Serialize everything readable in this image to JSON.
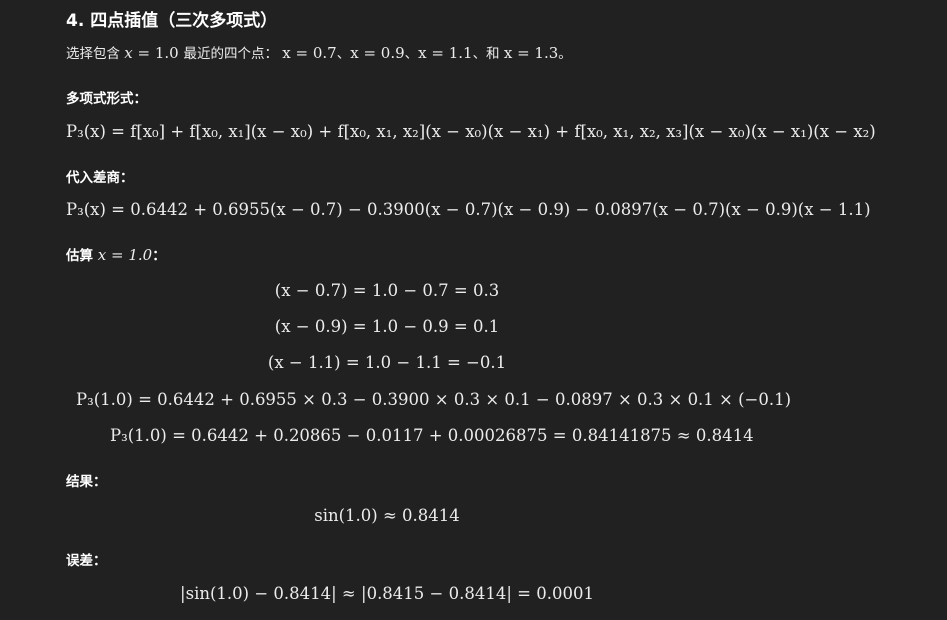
{
  "section_title": "4. 四点插值（三次多项式）",
  "intro": {
    "prefix": "选择包含",
    "x_var": "x",
    "eq_1": " = 1.0 ",
    "middle": "最近的四个点：",
    "p1": "x = 0.7",
    "sep1": "、",
    "p2": "x = 0.9",
    "sep2": "、",
    "p3": "x = 1.1",
    "sep3": "、和 ",
    "p4": "x = 1.3",
    "end": "。"
  },
  "labels": {
    "polynomial_form": "多项式形式：",
    "substitute": "代入差商：",
    "estimate_prefix": "估算",
    "estimate_expr": " x = 1.0",
    "estimate_suffix": "：",
    "result": "结果：",
    "error": "误差："
  },
  "equations": {
    "polynomial_form": "P₃(x) = f[x₀] + f[x₀, x₁](x − x₀) + f[x₀, x₁, x₂](x − x₀)(x − x₁) + f[x₀, x₁, x₂, x₃](x − x₀)(x − x₁)(x − x₂)",
    "substituted": "P₃(x) = 0.6442 + 0.6955(x − 0.7) − 0.3900(x − 0.7)(x − 0.9) − 0.0897(x − 0.7)(x − 0.9)(x − 1.1)",
    "diff1": "(x − 0.7) = 1.0 − 0.7 = 0.3",
    "diff2": "(x − 0.9) = 1.0 − 0.9 = 0.1",
    "diff3": "(x − 1.1) = 1.0 − 1.1 = −0.1",
    "eval1": "P₃(1.0) = 0.6442 + 0.6955 × 0.3 − 0.3900 × 0.3 × 0.1 − 0.0897 × 0.3 × 0.1 × (−0.1)",
    "eval2": "P₃(1.0) = 0.6442 + 0.20865 − 0.0117 + 0.00026875 = 0.84141875 ≈ 0.8414",
    "result": "sin(1.0) ≈ 0.8414",
    "error": "|sin(1.0) − 0.8414| ≈ |0.8415 − 0.8414| = 0.0001"
  }
}
